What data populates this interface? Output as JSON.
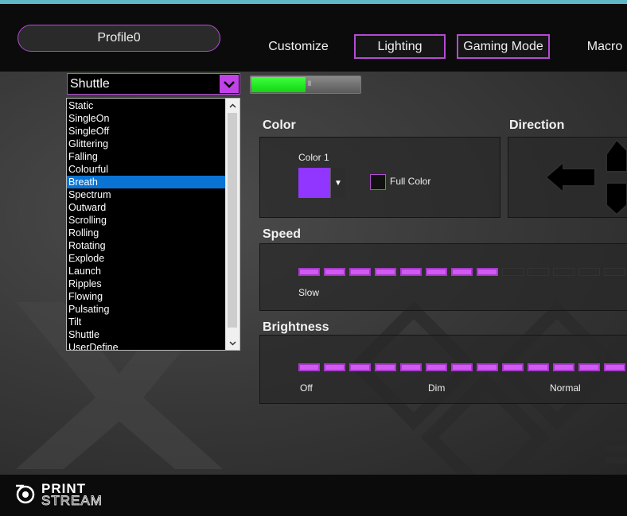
{
  "header": {
    "profile_label": "Profile0",
    "nav": [
      {
        "label": "Customize"
      },
      {
        "label": "Lighting"
      },
      {
        "label": "Gaming Mode"
      },
      {
        "label": "Macro"
      }
    ]
  },
  "effect": {
    "selected": "Shuttle",
    "options": [
      "Static",
      "SingleOn",
      "SingleOff",
      "Glittering",
      "Falling",
      "Colourful",
      "Breath",
      "Spectrum",
      "Outward",
      "Scrolling",
      "Rolling",
      "Rotating",
      "Explode",
      "Launch",
      "Ripples",
      "Flowing",
      "Pulsating",
      "Tilt",
      "Shuttle",
      "UserDefine"
    ],
    "highlighted": "Breath"
  },
  "lighting_toggle": {
    "on": true
  },
  "color": {
    "title": "Color",
    "color1_label": "Color 1",
    "color1_value": "#9136ff",
    "full_color_label": "Full Color",
    "full_color_checked": false
  },
  "direction": {
    "title": "Direction"
  },
  "speed": {
    "title": "Speed",
    "level": 8,
    "visible_segments": 13,
    "labels": [
      "Slow"
    ]
  },
  "brightness": {
    "title": "Brightness",
    "level": 13,
    "visible_segments": 13,
    "labels": [
      "Off",
      "Dim",
      "Normal"
    ]
  },
  "footer": {
    "logo_line1": "PRINT",
    "logo_line2": "STREAM"
  },
  "colors": {
    "accent": "#c142e6",
    "selection": "#0a74d4",
    "toggle_on": "#21e821"
  }
}
